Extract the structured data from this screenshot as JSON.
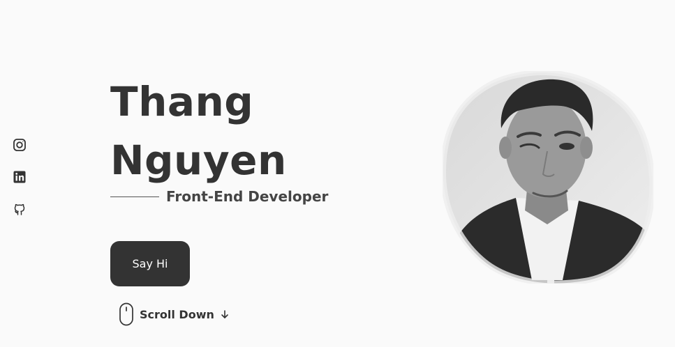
{
  "hero": {
    "first_name": "Thang",
    "last_name": "Nguyen",
    "subtitle": "Front-End Developer",
    "cta_label": "Say Hi",
    "scroll_label": "Scroll Down"
  },
  "social": [
    {
      "icon": "instagram-icon"
    },
    {
      "icon": "linkedin-icon"
    },
    {
      "icon": "github-icon"
    }
  ],
  "colors": {
    "background": "#fafafa",
    "text": "#333333",
    "button_bg": "#333333",
    "button_text": "#ffffff"
  }
}
